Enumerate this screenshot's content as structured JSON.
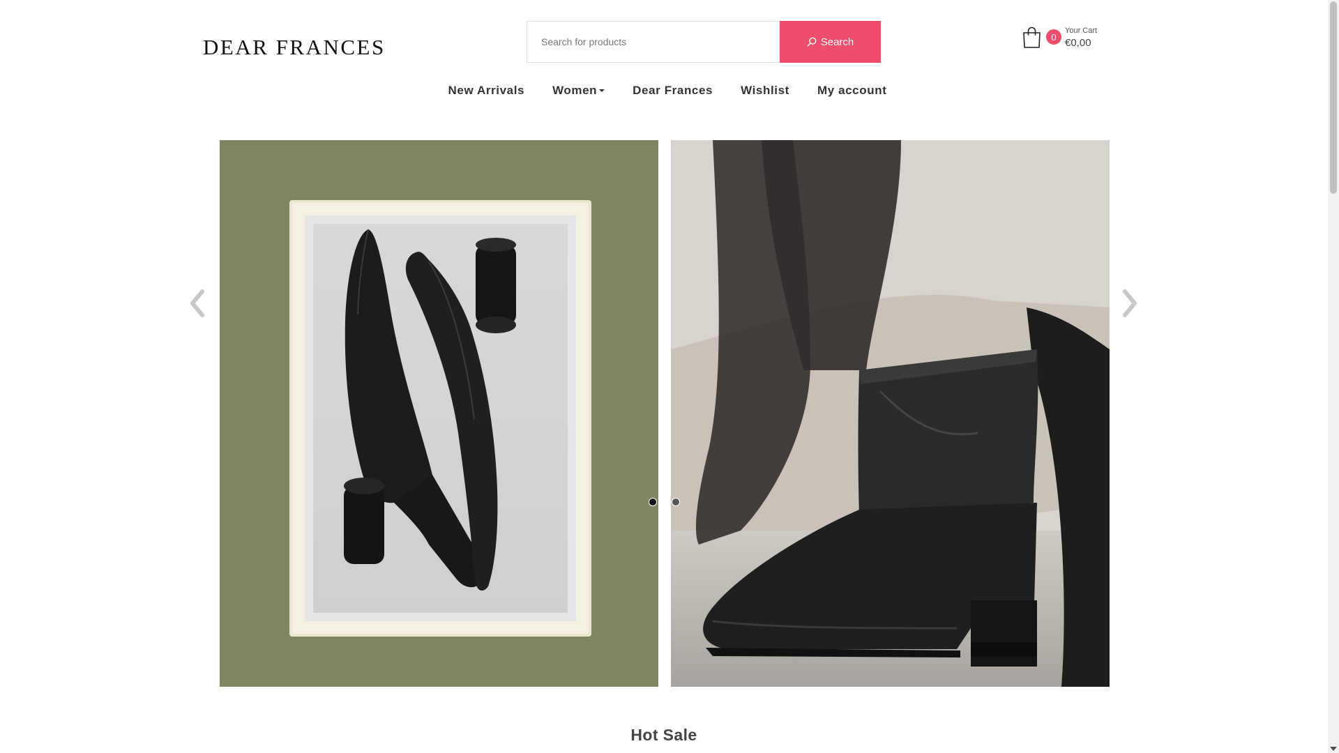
{
  "header": {
    "logo_text": "DEAR FRANCES",
    "search": {
      "placeholder": "Search for products",
      "button_label": "Search"
    },
    "cart": {
      "count": "0",
      "label": "Your Cart",
      "total": "€0,00"
    }
  },
  "nav": {
    "items": [
      {
        "label": "New Arrivals"
      },
      {
        "label": "Women"
      },
      {
        "label": "Dear Frances"
      },
      {
        "label": "Wishlist"
      },
      {
        "label": "My account"
      }
    ]
  },
  "slider": {
    "slides": [
      {
        "image": "black-leather-heeled-pumps-in-box"
      },
      {
        "image": "black-leather-ankle-boot-on-model"
      }
    ],
    "active_slide": 1,
    "dot_count": 2
  },
  "sections": {
    "hot_sale_title": "Hot Sale"
  },
  "colors": {
    "accent": "#ee4d6c",
    "slide_left_bg": "#808662",
    "slide_right_bg": "#d7d3cd"
  }
}
